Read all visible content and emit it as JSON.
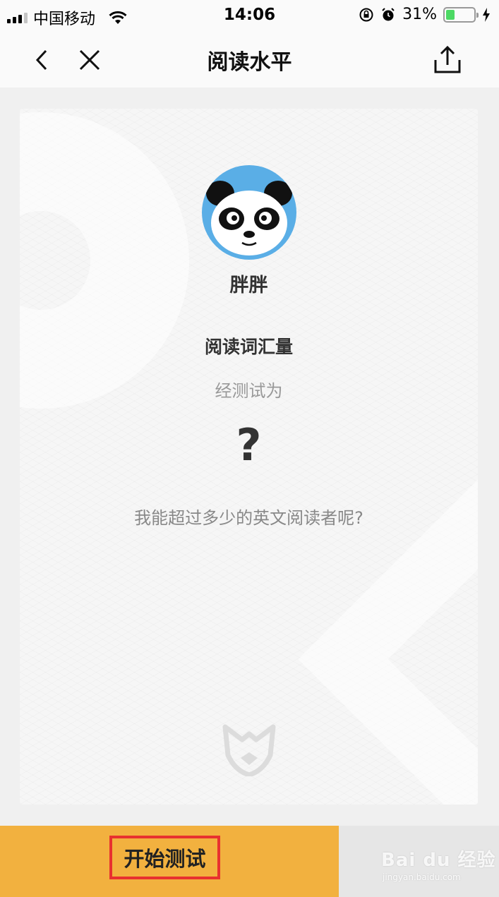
{
  "status_bar": {
    "carrier": "中国移动",
    "time": "14:06",
    "battery_percent_text": "31%",
    "battery_level": 0.31,
    "icons": [
      "signal-icon",
      "wifi-icon",
      "orientation-lock-icon",
      "alarm-icon",
      "battery-icon",
      "charging-icon"
    ]
  },
  "nav": {
    "title": "阅读水平",
    "back_icon": "chevron-left-icon",
    "close_icon": "close-icon",
    "share_icon": "share-icon"
  },
  "card": {
    "name": "胖胖",
    "vocab_title": "阅读词汇量",
    "vocab_subtitle": "经测试为",
    "vocab_value": "?",
    "question": "我能超过多少的英文阅读者呢?",
    "avatar_icon": "panda-avatar",
    "logo_icon": "fox-logo-icon"
  },
  "bottom": {
    "start_label": "开始测试",
    "watermark_text": "Bai du 经验",
    "watermark_sub": "jingyan.baidu.com"
  },
  "colors": {
    "start_bar": "#f2b13f",
    "highlight_border": "#e8312f",
    "avatar_bg": "#5aaee6",
    "battery_fill": "#4cd964"
  }
}
